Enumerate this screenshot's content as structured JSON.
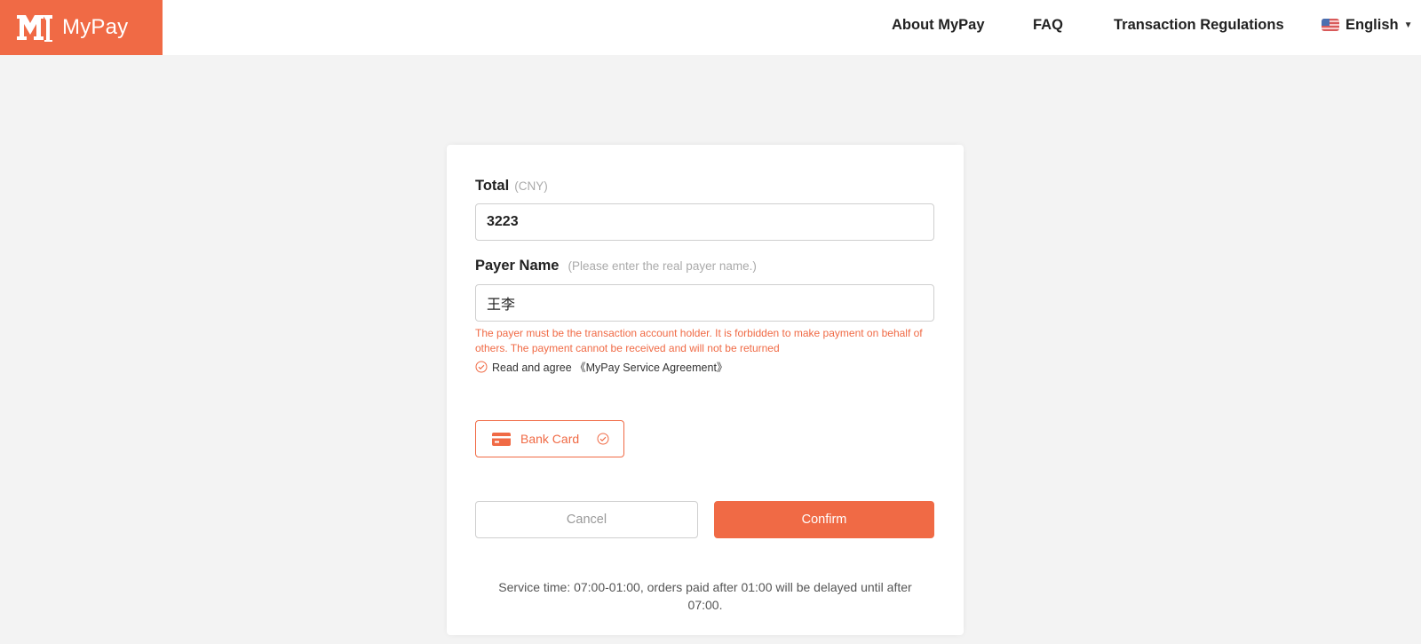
{
  "brand": {
    "name": "MyPay",
    "color": "#f06a45"
  },
  "nav": {
    "about": "About MyPay",
    "faq": "FAQ",
    "regulations": "Transaction Regulations",
    "language": "English",
    "language_icon": "us-flag-icon"
  },
  "form": {
    "total_label": "Total",
    "total_unit": "(CNY)",
    "total_value": "3223",
    "payer_label": "Payer Name",
    "payer_hint": "(Please enter the real payer name.)",
    "payer_value": "王李",
    "warning": "The payer must be the transaction account holder. It is forbidden to make payment on behalf of others. The payment cannot be received and will not be returned",
    "agree_text": "Read and agree 《MyPay Service Agreement》",
    "payment_method": "Bank Card",
    "cancel_label": "Cancel",
    "confirm_label": "Confirm",
    "service_time": "Service time: 07:00-01:00, orders paid after 01:00 will be delayed until after 07:00."
  }
}
